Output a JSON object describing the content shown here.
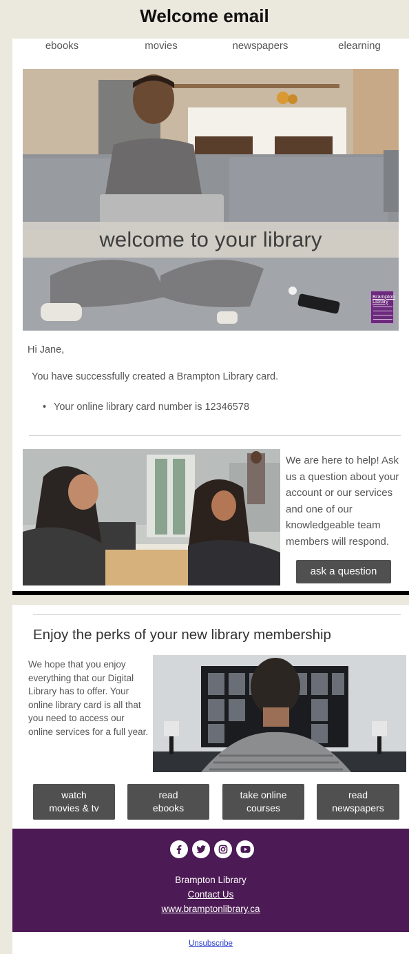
{
  "page_title": "Welcome email",
  "nav": {
    "items": [
      "ebooks",
      "movies",
      "newspapers",
      "elearning"
    ]
  },
  "hero": {
    "banner_text": "welcome to your library",
    "logo_text_1": "Brampton",
    "logo_text_2": "Library"
  },
  "greeting": "Hi Jane,",
  "success_message": "You have successfully created a Brampton Library card.",
  "card_number_line": "Your online library card number is 12346578",
  "help": {
    "text": "We are here to help! Ask us a question about your account or our services and one of our knowledgeable team members will respond.",
    "button_label": "ask a question"
  },
  "perks": {
    "title": "Enjoy the perks of your new library membership",
    "text": "We hope that you enjoy everything that our Digital Library has to offer.  Your online library card is all that you need to access our online services for a full year."
  },
  "actions": [
    {
      "line1": "watch",
      "line2": "movies & tv"
    },
    {
      "line1": "read",
      "line2": "ebooks"
    },
    {
      "line1": "take online",
      "line2": "courses"
    },
    {
      "line1": "read",
      "line2": "newspapers"
    }
  ],
  "footer": {
    "social_icons": [
      "facebook-icon",
      "twitter-icon",
      "instagram-icon",
      "youtube-icon"
    ],
    "org_name": "Brampton Library",
    "contact_label": "Contact Us",
    "website": "www.bramptonlibrary.ca",
    "background_color": "#4c1a54"
  },
  "unsubscribe_label": "Unsubscribe"
}
